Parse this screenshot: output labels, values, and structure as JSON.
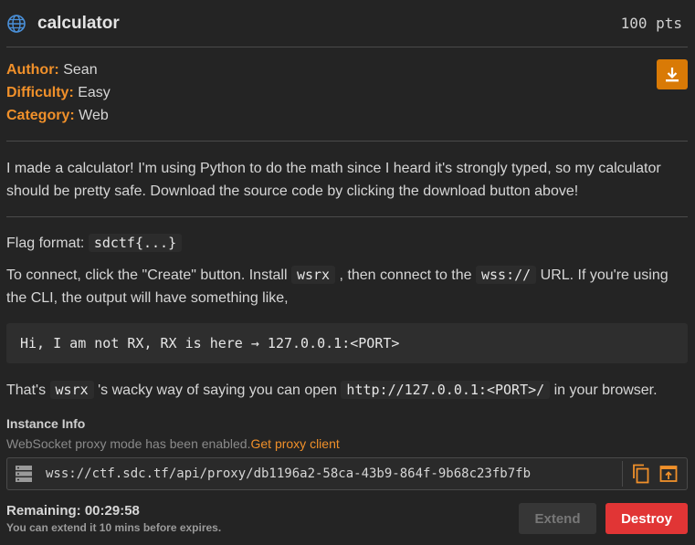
{
  "header": {
    "title": "calculator",
    "points": "100 pts",
    "icon": "globe-icon"
  },
  "meta": {
    "author_label": "Author:",
    "author": "Sean",
    "difficulty_label": "Difficulty:",
    "difficulty": "Easy",
    "category_label": "Category:",
    "category": "Web",
    "download_icon": "download-icon"
  },
  "description": "I made a calculator! I'm using Python to do the math since I heard it's strongly typed, so my calculator should be pretty safe. Download the source code by clicking the download button above!",
  "flag": {
    "label": "Flag format:",
    "value": "sdctf{...}"
  },
  "connect": {
    "part1": "To connect, click the \"Create\" button. Install",
    "tool": "wsrx",
    "part2": ", then connect to the",
    "scheme": "wss://",
    "part3": "URL. If you're using the CLI, the output will have something like,"
  },
  "code_output": "Hi, I am not RX, RX is here → 127.0.0.1:<PORT>",
  "browser": {
    "part1": "That's",
    "tool": "wsrx",
    "part2": "'s wacky way of saying you can open",
    "url": "http://127.0.0.1:<PORT>/",
    "part3": "in your browser."
  },
  "instance": {
    "title": "Instance Info",
    "note": "WebSocket proxy mode has been enabled.",
    "proxy_link": "Get proxy client",
    "url": "wss://ctf.sdc.tf/api/proxy/db1196a2-58ca-43b9-864f-9b68c23fb7fb",
    "remaining": "Remaining: 00:29:58",
    "extend_note": "You can extend it 10 mins before expires.",
    "extend_label": "Extend",
    "destroy_label": "Destroy"
  },
  "colors": {
    "accent": "#f0902a",
    "download_bg": "#d97a06",
    "destroy_bg": "#e13535",
    "globe": "#4a90d9"
  }
}
